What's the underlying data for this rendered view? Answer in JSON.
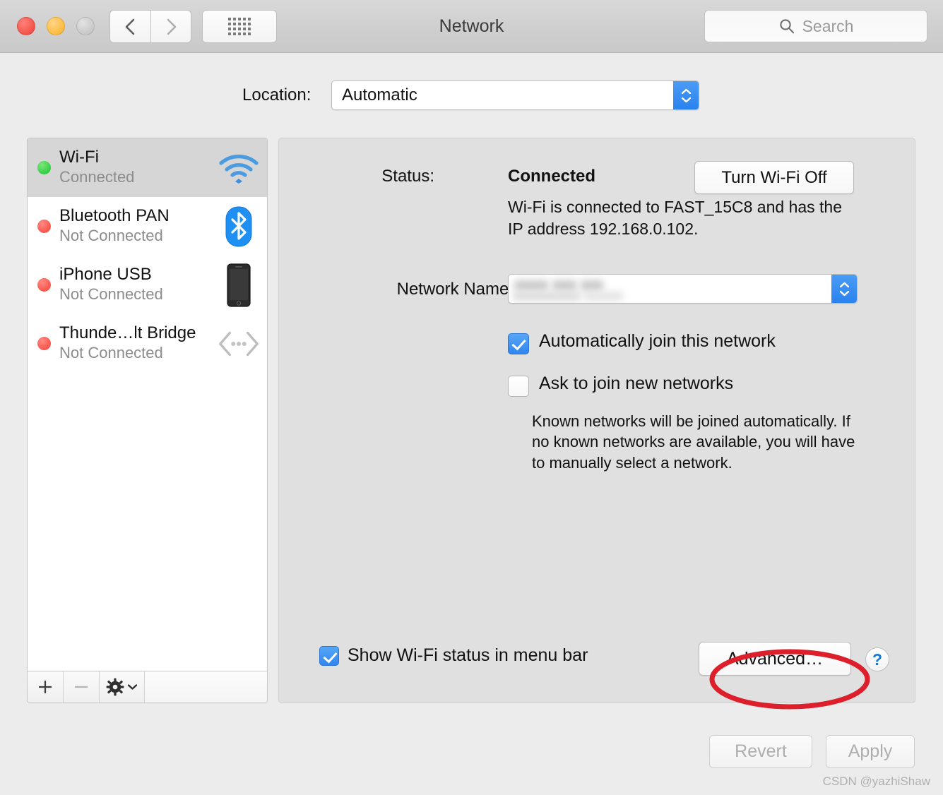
{
  "window": {
    "title": "Network",
    "traffic_lights": [
      "close-red",
      "minimize-yellow",
      "zoom-gray-disabled"
    ],
    "nav": {
      "back_icon": "chevron-left-icon",
      "forward_icon": "chevron-right-icon",
      "grid_icon": "show-all-grid-icon"
    },
    "search": {
      "placeholder": "Search",
      "icon": "search-icon"
    }
  },
  "location": {
    "label": "Location:",
    "value": "Automatic",
    "options": [
      "Automatic"
    ]
  },
  "sidebar": {
    "services": [
      {
        "name": "Wi-Fi",
        "status": "Connected",
        "dot": "green",
        "icon": "wifi-icon",
        "selected": true
      },
      {
        "name": "Bluetooth PAN",
        "status": "Not Connected",
        "dot": "red",
        "icon": "bluetooth-icon",
        "selected": false
      },
      {
        "name": "iPhone USB",
        "status": "Not Connected",
        "dot": "red",
        "icon": "iphone-icon",
        "selected": false
      },
      {
        "name": "Thunde…lt Bridge",
        "status": "Not Connected",
        "dot": "red",
        "icon": "thunderbolt-icon",
        "selected": false
      }
    ],
    "toolbar": {
      "add_icon": "plus-icon",
      "remove_icon": "minus-icon",
      "actions_icon": "gear-icon",
      "actions_chevron": "chevron-down-icon"
    }
  },
  "main": {
    "status_label": "Status:",
    "status_value": "Connected",
    "status_description": "Wi-Fi is connected to FAST_15C8 and has the IP address 192.168.0.102.",
    "turn_off_button": "Turn Wi-Fi Off",
    "network_name_label": "Network Name:",
    "network_name_value": "",
    "network_name_redacted": true,
    "auto_join": {
      "label": "Automatically join this network",
      "checked": true
    },
    "ask_join": {
      "label": "Ask to join new networks",
      "checked": false
    },
    "ask_join_help": "Known networks will be joined automatically. If no known networks are available, you will have to manually select a network.",
    "show_status_menu_bar": {
      "label": "Show Wi-Fi status in menu bar",
      "checked": true
    },
    "advanced_button": "Advanced…",
    "help_button": "?"
  },
  "footer": {
    "revert_button": "Revert",
    "revert_enabled": false,
    "apply_button": "Apply",
    "apply_enabled": false
  },
  "annotation": {
    "shape": "ellipse",
    "color": "#dc1f2b",
    "target": "advanced-button"
  },
  "watermark": "CSDN @yazhiShaw",
  "colors": {
    "accent_blue": "#3086ef",
    "status_green": "#2ecc3f",
    "status_red": "#f85349",
    "annotation_red": "#dc1f2b",
    "panel_bg": "#e0e0e0",
    "window_bg": "#ececec"
  }
}
